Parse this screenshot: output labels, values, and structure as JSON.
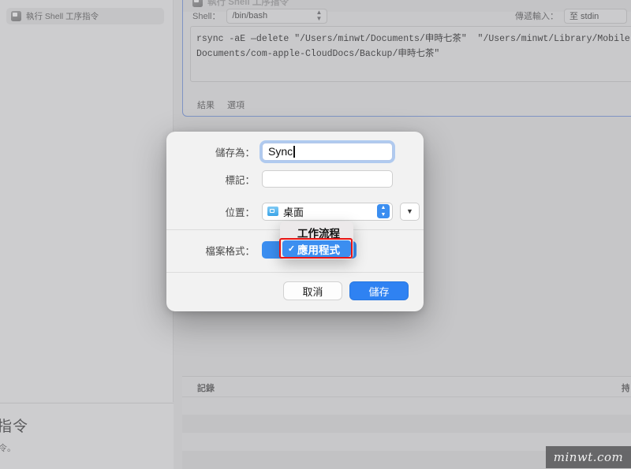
{
  "sidebar": {
    "action_item": {
      "label": "執行 Shell 工序指令",
      "icon": "script-app-icon"
    },
    "description": {
      "title": "序指令",
      "body": "序指令。"
    }
  },
  "workflow": {
    "action_card": {
      "title": "執行 Shell 工序指令",
      "shell_label": "Shell：",
      "shell_value": "/bin/bash",
      "pass_input_label": "傳遞輸入：",
      "pass_input_value": "至 stdin",
      "script": "rsync -aE —delete \"/Users/minwt/Documents/申時七茶\"  \"/Users/minwt/Library/Mobile\nDocuments/com-apple-CloudDocs/Backup/申時七茶\"",
      "tabs": [
        {
          "label": "結果"
        },
        {
          "label": "選項"
        }
      ]
    }
  },
  "log_pane": {
    "title": "記錄",
    "right_title": "持"
  },
  "save_sheet": {
    "save_as_label": "儲存為：",
    "save_as_value": "Sync",
    "tags_label": "標記：",
    "tags_value": "",
    "location_label": "位置：",
    "location_value": "桌面",
    "location_icon": "blue-folder-icon",
    "stepper_up": "▲",
    "stepper_down": "▼",
    "expand_icon": "chevron-down-icon",
    "format_label": "檔案格式：",
    "cancel_label": "取消",
    "save_label": "儲存"
  },
  "format_menu": {
    "items": [
      {
        "label": "工作流程",
        "checked": false
      },
      {
        "label": "應用程式",
        "checked": true
      }
    ],
    "check_glyph": "✓",
    "highlight_color": "#3b8ef0",
    "annotation_color": "#e81414"
  },
  "watermark": {
    "text": "minwt.com"
  }
}
